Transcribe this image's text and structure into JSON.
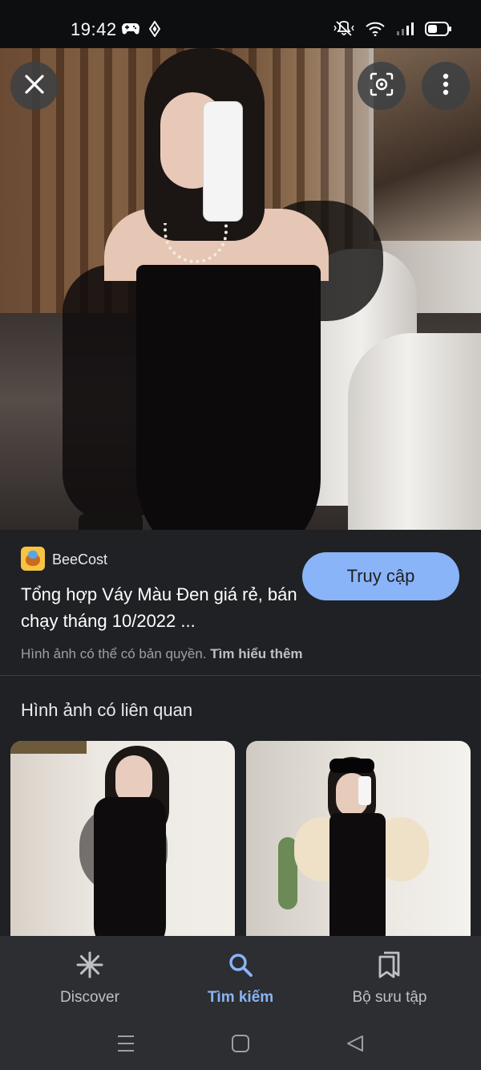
{
  "status_bar": {
    "time": "19:42"
  },
  "hero": {
    "close_label": "close",
    "lens_label": "lens",
    "more_label": "more"
  },
  "result": {
    "source_name": "BeeCost",
    "title": "Tổng hợp Váy Màu Đen giá rẻ, bán chạy tháng 10/2022 ...",
    "visit_button": "Truy cập",
    "copyright_text": "Hình ảnh có thể có bản quyền.",
    "learn_more": "Tìm hiểu thêm"
  },
  "related": {
    "heading": "Hình ảnh có liên quan"
  },
  "bottom_nav": {
    "items": [
      {
        "label": "Discover",
        "icon": "asterisk-icon"
      },
      {
        "label": "Tìm kiếm",
        "icon": "search-icon",
        "active": true
      },
      {
        "label": "Bộ sưu tập",
        "icon": "bookmark-icon"
      }
    ]
  },
  "colors": {
    "accent": "#8ab4f8",
    "background": "#202124",
    "nav_background": "#2d2e31"
  }
}
